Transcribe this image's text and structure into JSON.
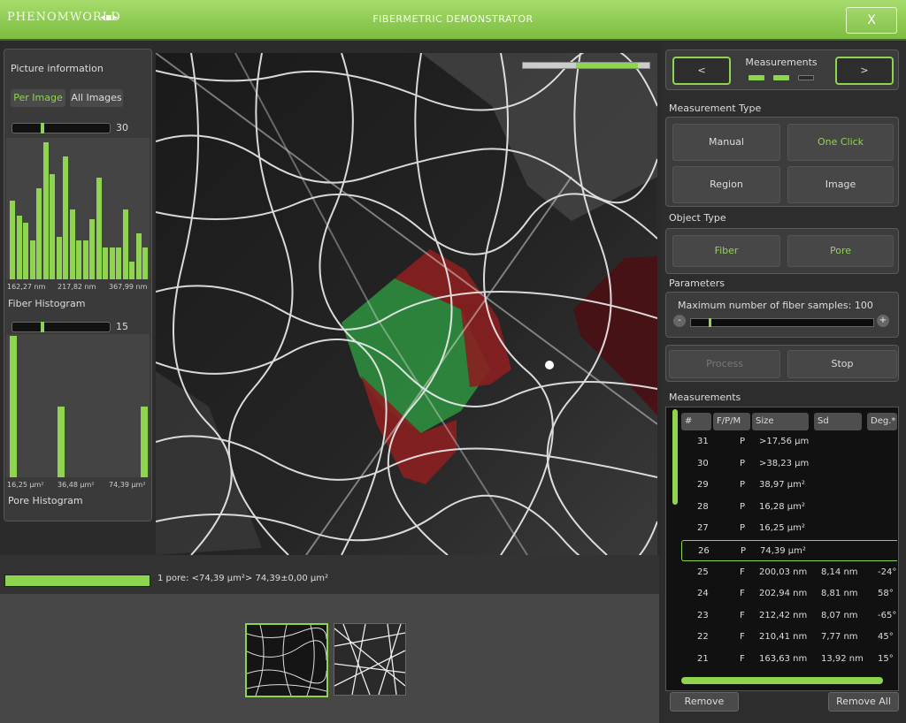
{
  "titlebar": {
    "logo": "PHENOMWORLD",
    "title": "FIBERMETRIC  DEMONSTRATOR",
    "close_label": "X"
  },
  "left": {
    "picture_info_title": "Picture information",
    "per_image_label": "Per Image",
    "all_images_label": "All Images",
    "fiber_slider_value": "30",
    "fiber_hist_bars": [
      45,
      36,
      32,
      22,
      52,
      78,
      60,
      24,
      70,
      40,
      22,
      22,
      34,
      58,
      18,
      18,
      18,
      40,
      10,
      26,
      18
    ],
    "fiber_axis": [
      "162,27 nm",
      "217,82 nm",
      "367,99 nm"
    ],
    "fiber_caption": "Fiber Histogram",
    "pore_slider_value": "15",
    "pore_axis": [
      "16,25 µm²",
      "36,48 µm²",
      "74,39 µm²"
    ],
    "pore_caption": "Pore Histogram"
  },
  "status": {
    "text": "1 pore: <74,39 µm²> 74,39±0,00 µm²"
  },
  "right": {
    "prev_label": "<",
    "next_label": ">",
    "measurements_title": "Measurements",
    "measurement_type_title": "Measurement Type",
    "manual": "Manual",
    "one_click": "One Click",
    "region": "Region",
    "image": "Image",
    "object_type_title": "Object Type",
    "fiber": "Fiber",
    "pore": "Pore",
    "parameters_title": "Parameters",
    "max_samples_label": "Maximum number of fiber samples: 100",
    "minus": "-",
    "plus": "+",
    "process": "Process",
    "stop": "Stop",
    "measurements_list_title": "Measurements",
    "headers": [
      "#",
      "F/P/M",
      "Size",
      "Sd",
      "Deg.*"
    ],
    "rows": [
      {
        "n": "31",
        "t": "P",
        "size": ">17,56 µm",
        "sd": "",
        "deg": ""
      },
      {
        "n": "30",
        "t": "P",
        "size": ">38,23 µm",
        "sd": "",
        "deg": ""
      },
      {
        "n": "29",
        "t": "P",
        "size": "38,97 µm²",
        "sd": "",
        "deg": ""
      },
      {
        "n": "28",
        "t": "P",
        "size": "16,28 µm²",
        "sd": "",
        "deg": ""
      },
      {
        "n": "27",
        "t": "P",
        "size": "16,25 µm²",
        "sd": "",
        "deg": ""
      },
      {
        "n": "26",
        "t": "P",
        "size": "74,39 µm²",
        "sd": "",
        "deg": ""
      },
      {
        "n": "25",
        "t": "F",
        "size": "200,03 nm",
        "sd": "8,14 nm",
        "deg": "-24°"
      },
      {
        "n": "24",
        "t": "F",
        "size": "202,94 nm",
        "sd": "8,81 nm",
        "deg": "58°"
      },
      {
        "n": "23",
        "t": "F",
        "size": "212,42 nm",
        "sd": "8,07 nm",
        "deg": "-65°"
      },
      {
        "n": "22",
        "t": "F",
        "size": "210,41 nm",
        "sd": "7,77 nm",
        "deg": "45°"
      },
      {
        "n": "21",
        "t": "F",
        "size": "163,63 nm",
        "sd": "13,92 nm",
        "deg": "15°"
      }
    ],
    "remove": "Remove",
    "remove_all": "Remove All"
  },
  "colors": {
    "accent": "#8fd44f",
    "pore_selected": "#2e8b3e",
    "pore_marked": "#8a1f1f"
  }
}
